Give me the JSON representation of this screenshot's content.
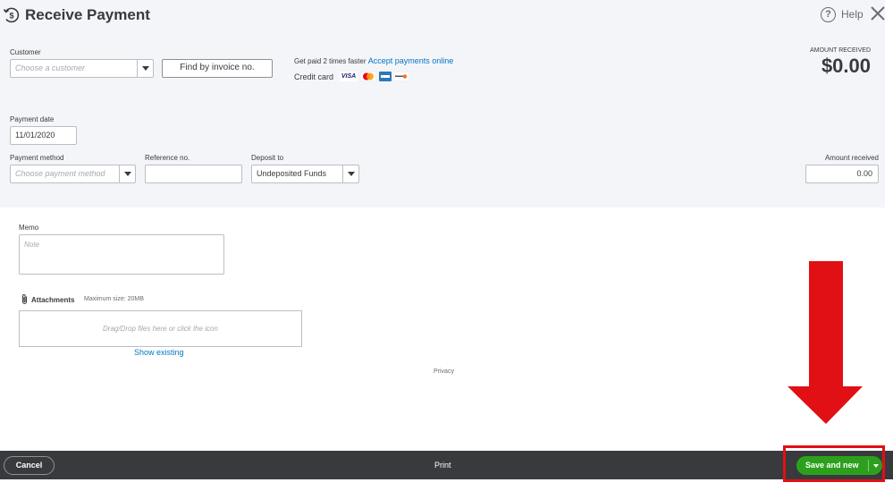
{
  "header": {
    "title": "Receive Payment",
    "help_label": "Help",
    "icons": {
      "title": "payment-clock-icon",
      "help": "question-circle-icon",
      "close": "close-icon"
    }
  },
  "customer": {
    "label": "Customer",
    "placeholder": "Choose a customer",
    "find_button": "Find by invoice no."
  },
  "promo": {
    "text": "Get paid 2 times faster",
    "link": "Accept payments online",
    "credit_card_label": "Credit card",
    "cards": [
      "VISA",
      "Mastercard",
      "American Express",
      "Discover"
    ]
  },
  "amount_received_summary": {
    "label": "AMOUNT RECEIVED",
    "value": "$0.00"
  },
  "payment_date": {
    "label": "Payment date",
    "value": "11/01/2020"
  },
  "payment_method": {
    "label": "Payment method",
    "placeholder": "Choose payment method"
  },
  "reference": {
    "label": "Reference no.",
    "value": ""
  },
  "deposit_to": {
    "label": "Deposit to",
    "value": "Undeposited Funds"
  },
  "amount_received_field": {
    "label": "Amount received",
    "value": "0.00"
  },
  "memo": {
    "label": "Memo",
    "placeholder": "Note"
  },
  "attachments": {
    "label": "Attachments",
    "max_size": "Maximum size: 20MB",
    "dropzone": "Drag/Drop files here or click the icon",
    "show_existing": "Show existing"
  },
  "privacy_label": "Privacy",
  "footer": {
    "cancel": "Cancel",
    "print": "Print",
    "save": "Save and new"
  },
  "colors": {
    "save_green": "#2ca01c",
    "link_blue": "#0077c5",
    "annotation_red": "#e01015",
    "footer_bg": "#393a3d"
  }
}
